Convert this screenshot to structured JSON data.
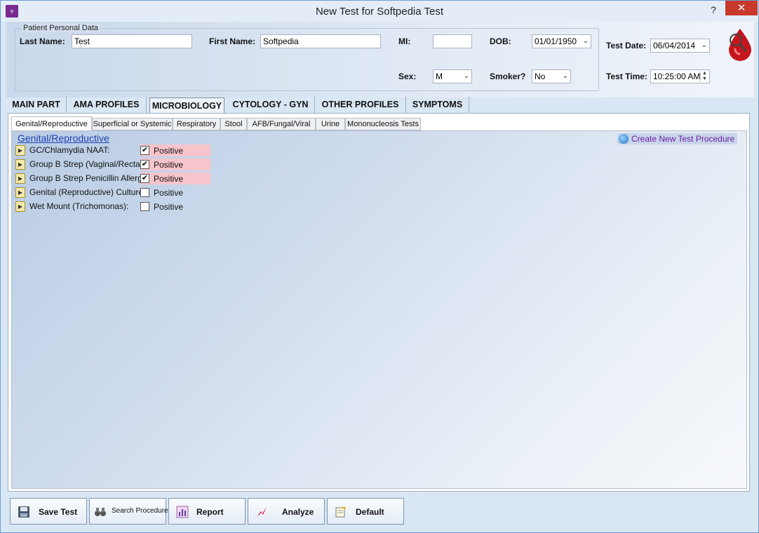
{
  "window": {
    "title": "New Test for Softpedia Test",
    "help_glyph": "?",
    "close_glyph": "✕",
    "app_icon_glyph": "♆"
  },
  "patient": {
    "group_label": "Patient Personal Data",
    "last_name_label": "Last Name:",
    "last_name_value": "Test",
    "first_name_label": "First Name:",
    "first_name_value": "Softpedia",
    "mi_label": "MI:",
    "mi_value": "",
    "dob_label": "DOB:",
    "dob_value": "01/01/1950",
    "sex_label": "Sex:",
    "sex_value": "M",
    "smoker_label": "Smoker?",
    "smoker_value": "No"
  },
  "test": {
    "date_label": "Test Date:",
    "date_value": "06/04/2014",
    "time_label": "Test Time:",
    "time_value": "10:25:00 AM"
  },
  "main_tabs": [
    {
      "label": "MAIN PART",
      "active": false
    },
    {
      "label": "AMA PROFILES",
      "active": false
    },
    {
      "label": "MICROBIOLOGY",
      "active": true
    },
    {
      "label": "CYTOLOGY - GYN",
      "active": false
    },
    {
      "label": "OTHER PROFILES",
      "active": false
    },
    {
      "label": "SYMPTOMS",
      "active": false
    }
  ],
  "sub_tabs": [
    {
      "label": "Genital/Reproductive",
      "active": true
    },
    {
      "label": "Superficial or Systemic",
      "active": false
    },
    {
      "label": "Respiratory",
      "active": false
    },
    {
      "label": "Stool",
      "active": false
    },
    {
      "label": "AFB/Fungal/Viral",
      "active": false
    },
    {
      "label": "Urine",
      "active": false
    },
    {
      "label": "Mononucleosis Tests",
      "active": false
    }
  ],
  "section": {
    "title": "Genital/Reproductive",
    "create_link": "Create New Test Procedure"
  },
  "procedures": [
    {
      "label": "GC/Chlamydia NAAT:",
      "result_label": "Positive",
      "checked": true
    },
    {
      "label": "Group B Strep (Vaginal/Rectal):",
      "result_label": "Positive",
      "checked": true
    },
    {
      "label": "Group B Strep Penicillin Allergic:",
      "result_label": "Positive",
      "checked": true
    },
    {
      "label": "Genital (Reproductive) Culture:",
      "result_label": "Positive",
      "checked": false
    },
    {
      "label": "Wet Mount (Trichomonas):",
      "result_label": "Positive",
      "checked": false
    }
  ],
  "toolbar": {
    "save_label": "Save Test",
    "search_label": "Search Procedure",
    "report_label": "Report",
    "analyze_label": "Analyze",
    "default_label": "Default"
  },
  "colors": {
    "positive_highlight": "#f8c4cc",
    "link_blue": "#1a3fb5",
    "create_link_purple": "#6a1fa3",
    "close_red": "#c7392b"
  },
  "glyphs": {
    "check": "✔",
    "expander": "▶",
    "combo_arrow": "⌄",
    "spin_up": "▲",
    "spin_down": "▼"
  }
}
